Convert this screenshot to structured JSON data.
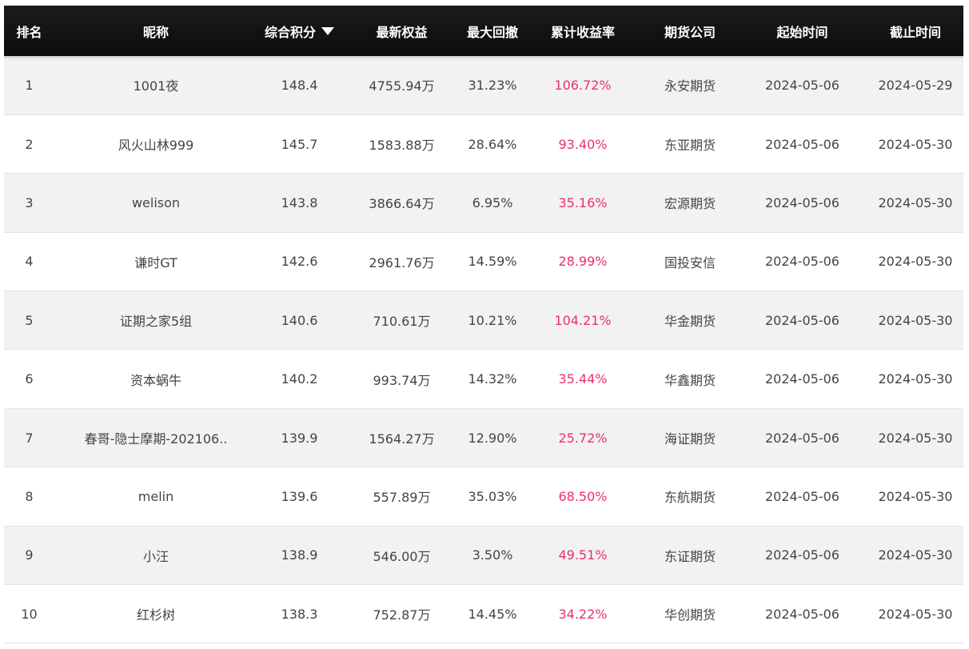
{
  "colors": {
    "header_bg": "#111111",
    "return_color": "#e8316a",
    "row_alt_bg": "#f2f2f2"
  },
  "header": {
    "rank": "排名",
    "nickname": "昵称",
    "score": "综合积分",
    "score_sort_icon": "sort-desc-icon",
    "equity": "最新权益",
    "drawdown": "最大回撤",
    "return": "累计收益率",
    "company": "期货公司",
    "start": "起始时间",
    "end": "截止时间"
  },
  "rows": [
    {
      "rank": "1",
      "nickname": "1001夜",
      "score": "148.4",
      "equity": "4755.94万",
      "drawdown": "31.23%",
      "return": "106.72%",
      "company": "永安期货",
      "start": "2024-05-06",
      "end": "2024-05-29"
    },
    {
      "rank": "2",
      "nickname": "风火山林999",
      "score": "145.7",
      "equity": "1583.88万",
      "drawdown": "28.64%",
      "return": "93.40%",
      "company": "东亚期货",
      "start": "2024-05-06",
      "end": "2024-05-30"
    },
    {
      "rank": "3",
      "nickname": "welison",
      "score": "143.8",
      "equity": "3866.64万",
      "drawdown": "6.95%",
      "return": "35.16%",
      "company": "宏源期货",
      "start": "2024-05-06",
      "end": "2024-05-30"
    },
    {
      "rank": "4",
      "nickname": "谦时GT",
      "score": "142.6",
      "equity": "2961.76万",
      "drawdown": "14.59%",
      "return": "28.99%",
      "company": "国投安信",
      "start": "2024-05-06",
      "end": "2024-05-30"
    },
    {
      "rank": "5",
      "nickname": "证期之家5组",
      "score": "140.6",
      "equity": "710.61万",
      "drawdown": "10.21%",
      "return": "104.21%",
      "company": "华金期货",
      "start": "2024-05-06",
      "end": "2024-05-30"
    },
    {
      "rank": "6",
      "nickname": "资本蜗牛",
      "score": "140.2",
      "equity": "993.74万",
      "drawdown": "14.32%",
      "return": "35.44%",
      "company": "华鑫期货",
      "start": "2024-05-06",
      "end": "2024-05-30"
    },
    {
      "rank": "7",
      "nickname": "春哥-隐士摩期-202106..",
      "score": "139.9",
      "equity": "1564.27万",
      "drawdown": "12.90%",
      "return": "25.72%",
      "company": "海证期货",
      "start": "2024-05-06",
      "end": "2024-05-30"
    },
    {
      "rank": "8",
      "nickname": "melin",
      "score": "139.6",
      "equity": "557.89万",
      "drawdown": "35.03%",
      "return": "68.50%",
      "company": "东航期货",
      "start": "2024-05-06",
      "end": "2024-05-30"
    },
    {
      "rank": "9",
      "nickname": "小汪",
      "score": "138.9",
      "equity": "546.00万",
      "drawdown": "3.50%",
      "return": "49.51%",
      "company": "东证期货",
      "start": "2024-05-06",
      "end": "2024-05-30"
    },
    {
      "rank": "10",
      "nickname": "红杉树",
      "score": "138.3",
      "equity": "752.87万",
      "drawdown": "14.45%",
      "return": "34.22%",
      "company": "华创期货",
      "start": "2024-05-06",
      "end": "2024-05-30"
    }
  ]
}
